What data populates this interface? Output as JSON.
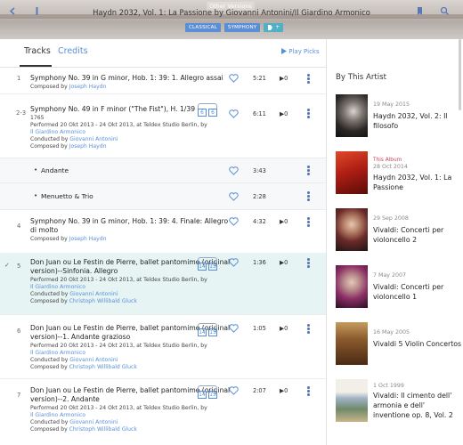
{
  "header": {
    "title": "Haydn 2032, Vol. 1: La Passione by Giovanni Antonini/Il Giardino Armonico",
    "other_versions": "Other Versions",
    "tags": [
      "CLASSICAL",
      "SYMPHONY"
    ],
    "tag_add": "+",
    "icons": [
      "back-icon",
      "menu-icon",
      "bookmark-icon",
      "search-icon"
    ]
  },
  "tabs": {
    "tracks": "Tracks",
    "credits": "Credits",
    "play_picks": "Play Picks"
  },
  "tracks": [
    {
      "num": "1",
      "title": "Symphony No. 39 in G minor, Hob. 1: 39: 1. Allegro assai",
      "composed_label": "Composed by",
      "composer": "Joseph Haydn",
      "duration": "5:21",
      "plays": "0"
    },
    {
      "num": "2-3",
      "title": "Symphony No. 49 in F minor (\"The Fist\"), H. 1/39",
      "year": "1765",
      "performed": "Performed 20 Okt 2013 - 24 Okt 2013, at Teldex Studio Berlin, by",
      "performer": "Il Giardino Armonico",
      "conducted_label": "Conducted by",
      "conductor": "Giovanni Antonini",
      "composed_label": "Composed by",
      "composer": "Joseph Haydn",
      "hd": [
        "6",
        "6"
      ],
      "duration": "6:11",
      "plays": "0"
    },
    {
      "num": "",
      "movements": [
        {
          "title": "Andante",
          "duration": "3:43"
        },
        {
          "title": "Menuetto & Trio",
          "duration": "2:28"
        }
      ]
    },
    {
      "num": "4",
      "title": "Symphony No. 39 in G minor, Hob. 1: 39: 4. Finale: Allegro di molto",
      "composed_label": "Composed by",
      "composer": "Joseph Haydn",
      "duration": "4:32",
      "plays": "0"
    },
    {
      "num": "5",
      "title": "Don Juan ou Le Festin de Pierre, ballet pantomime (original version)--Sinfonia. Allegro",
      "performed": "Performed 20 Okt 2013 - 24 Okt 2013, at Teldex Studio Berlin, by",
      "performer": "Il Giardino Armonico",
      "conducted_label": "Conducted by",
      "conductor": "Giovanni Antonini",
      "composed_label": "Composed by",
      "composer": "Christoph Willibald Gluck",
      "hd": [
        "14",
        "15"
      ],
      "duration": "1:36",
      "plays": "0",
      "check": "✓"
    },
    {
      "num": "6",
      "title": "Don Juan ou Le Festin de Pierre, ballet pantomime (original version)--1. Andante grazioso",
      "performed": "Performed 20 Okt 2013 - 24 Okt 2013, at Teldex Studio Berlin, by",
      "performer": "Il Giardino Armonico",
      "conducted_label": "Conducted by",
      "conductor": "Giovanni Antonini",
      "composed_label": "Composed by",
      "composer": "Christoph Willibald Gluck",
      "hd": [
        "14",
        "15"
      ],
      "duration": "1:05",
      "plays": "0"
    },
    {
      "num": "7",
      "title": "Don Juan ou Le Festin de Pierre, ballet pantomime (original version)--2. Andante",
      "performed": "Performed 20 Okt 2013 - 24 Okt 2013, at Teldex Studio Berlin, by",
      "performer": "Il Giardino Armonico",
      "conducted_label": "Conducted by",
      "conductor": "Giovanni Antonini",
      "composed_label": "Composed by",
      "composer": "Christoph Willibald Gluck",
      "hd": [
        "14",
        "15"
      ],
      "duration": "2:07",
      "plays": "0"
    }
  ],
  "sidebar": {
    "title": "By This Artist",
    "albums": [
      {
        "date": "19 May 2015",
        "title": "Haydn 2032, Vol. 2: Il filosofo"
      },
      {
        "tag": "This Album",
        "date": "28 Oct 2014",
        "title": "Haydn 2032, Vol. 1: La Passione"
      },
      {
        "date": "29 Sep 2008",
        "title": "Vivaldi: Concerti per violoncello 2"
      },
      {
        "date": "7 May 2007",
        "title": "Vivaldi: Concerti per violoncello 1"
      },
      {
        "date": "16 May 2005",
        "title": "Vivaldi 5 Violin Concertos"
      },
      {
        "date": "1 Oct 1999",
        "title": "Vivaldi: Il cimento dell' armonia e dell' inventione op. 8, Vol. 2"
      }
    ]
  },
  "colors": {
    "accent": "#5a8fd6",
    "highlight_row": "#e6f4f4",
    "this_album": "#cc4455"
  }
}
